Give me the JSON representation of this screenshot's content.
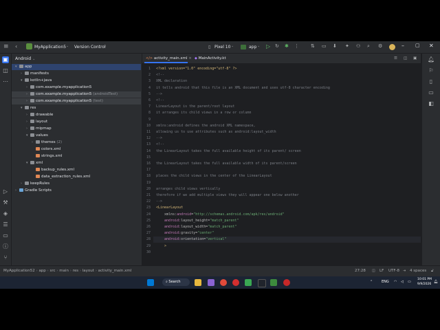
{
  "titlebar": {
    "project": "MyApplication5",
    "vcs": "Version Control",
    "device": "Pixel 10",
    "run_config": "app"
  },
  "project_panel": {
    "view": "Android",
    "tree": [
      {
        "label": "app",
        "indent": 0,
        "arrow": "▾",
        "kind": "folder",
        "selected": true
      },
      {
        "label": "manifests",
        "indent": 1,
        "arrow": "›",
        "kind": "folder"
      },
      {
        "label": "kotlin+java",
        "indent": 1,
        "arrow": "▾",
        "kind": "folder"
      },
      {
        "label": "com.example.myapplication5",
        "indent": 2,
        "arrow": "›",
        "kind": "pkg"
      },
      {
        "label": "com.example.myapplication5",
        "suffix": "(androidTest)",
        "indent": 2,
        "arrow": "›",
        "kind": "pkg",
        "highlight": true
      },
      {
        "label": "com.example.myapplication5",
        "suffix": "(test)",
        "indent": 2,
        "arrow": "›",
        "kind": "pkg",
        "highlight": true
      },
      {
        "label": "res",
        "indent": 1,
        "arrow": "▾",
        "kind": "folder"
      },
      {
        "label": "drawable",
        "indent": 2,
        "arrow": "›",
        "kind": "folder"
      },
      {
        "label": "layout",
        "indent": 2,
        "arrow": "›",
        "kind": "folder"
      },
      {
        "label": "mipmap",
        "indent": 2,
        "arrow": "›",
        "kind": "folder"
      },
      {
        "label": "values",
        "indent": 2,
        "arrow": "▾",
        "kind": "folder"
      },
      {
        "label": "themes",
        "suffix": "(2)",
        "indent": 3,
        "arrow": "›",
        "kind": "folder"
      },
      {
        "label": "colors.xml",
        "indent": 3,
        "arrow": "",
        "kind": "xml"
      },
      {
        "label": "strings.xml",
        "indent": 3,
        "arrow": "",
        "kind": "xml"
      },
      {
        "label": "xml",
        "indent": 2,
        "arrow": "▾",
        "kind": "folder"
      },
      {
        "label": "backup_rules.xml",
        "indent": 3,
        "arrow": "",
        "kind": "xml"
      },
      {
        "label": "data_extraction_rules.xml",
        "indent": 3,
        "arrow": "",
        "kind": "xml"
      },
      {
        "label": "keepRules",
        "indent": 1,
        "arrow": "›",
        "kind": "folder"
      },
      {
        "label": "Gradle Scripts",
        "indent": 0,
        "arrow": "›",
        "kind": "gradle"
      }
    ]
  },
  "editor": {
    "tabs": [
      "activity_main.xml",
      "MainActivity.kt"
    ],
    "lines": [
      [
        {
          "t": "<?xml version=\"1.0\" encoding=\"utf-8\" ?>",
          "c": "tag"
        }
      ],
      [
        {
          "t": "<!--",
          "c": "cmt"
        }
      ],
      [
        {
          "t": "XML declaration",
          "c": "cmt"
        }
      ],
      [
        {
          "t": "it tells android that this file is an XML document and uses utf-8 character encoding",
          "c": "cmt"
        }
      ],
      [
        {
          "t": "-->",
          "c": "cmt"
        }
      ],
      [
        {
          "t": "<!--",
          "c": "cmt"
        }
      ],
      [
        {
          "t": "LinearLayout is the parent/root layout",
          "c": "cmt"
        }
      ],
      [
        {
          "t": "it arranges its child views in a row or column",
          "c": "cmt"
        }
      ],
      [
        {
          "t": "",
          "c": "cmt"
        }
      ],
      [
        {
          "t": "xmlns:android defines the android XML namespace,",
          "c": "cmt"
        }
      ],
      [
        {
          "t": "allowing us to use attributes such as android:layout_width",
          "c": "cmt"
        }
      ],
      [
        {
          "t": "-->",
          "c": "cmt"
        }
      ],
      [
        {
          "t": "<!--",
          "c": "cmt"
        }
      ],
      [
        {
          "t": "the LinearLayout takes the full available height of its parent/ screen",
          "c": "cmt"
        }
      ],
      [
        {
          "t": "",
          "c": "cmt"
        }
      ],
      [
        {
          "t": "the LinearLayout takes the full available width of its parent/screen",
          "c": "cmt"
        }
      ],
      [
        {
          "t": "",
          "c": "cmt"
        }
      ],
      [
        {
          "t": "places the child views in the center of the LinearLayout",
          "c": "cmt"
        }
      ],
      [
        {
          "t": "",
          "c": "cmt"
        }
      ],
      [
        {
          "t": "arranges child views vertically",
          "c": "cmt"
        }
      ],
      [
        {
          "t": "therefore if we add multiple views they will appear one below another",
          "c": "cmt"
        }
      ],
      [
        {
          "t": "-->",
          "c": "cmt"
        }
      ],
      [
        {
          "t": "<LinearLayout",
          "c": "tag"
        }
      ],
      [
        {
          "t": "    xmlns:",
          "c": "attr"
        },
        {
          "t": "android",
          "c": "ns"
        },
        {
          "t": "=",
          "c": "attr"
        },
        {
          "t": "\"http://schemas.android.com/apk/res/android\"",
          "c": "val"
        }
      ],
      [
        {
          "t": "    android:",
          "c": "ns"
        },
        {
          "t": "layout_height",
          "c": "attr"
        },
        {
          "t": "=",
          "c": "attr"
        },
        {
          "t": "\"match_parent\"",
          "c": "val"
        }
      ],
      [
        {
          "t": "    android:",
          "c": "ns"
        },
        {
          "t": "layout_width",
          "c": "attr"
        },
        {
          "t": "=",
          "c": "attr"
        },
        {
          "t": "\"match_parent\"",
          "c": "val"
        }
      ],
      [
        {
          "t": "    android:",
          "c": "ns"
        },
        {
          "t": "gravity",
          "c": "attr"
        },
        {
          "t": "=",
          "c": "attr"
        },
        {
          "t": "\"center\"",
          "c": "val"
        }
      ],
      [
        {
          "t": "    android:",
          "c": "ns"
        },
        {
          "t": "orientation",
          "c": "attr"
        },
        {
          "t": "=",
          "c": "attr"
        },
        {
          "t": "\"vertical\"",
          "c": "val"
        }
      ],
      [
        {
          "t": "    >",
          "c": "tag"
        }
      ],
      [
        {
          "t": "",
          "c": "cmt"
        }
      ]
    ],
    "current_line": 28
  },
  "statusbar": {
    "breadcrumb": [
      "MyApplication52",
      "app",
      "src",
      "main",
      "res",
      "layout",
      "activity_main.xml"
    ],
    "position": "27:28",
    "line_sep": "LF",
    "encoding": "UTF-8",
    "indent": "4 spaces"
  },
  "taskbar": {
    "search": "Search",
    "lang": "ENG",
    "time": "10:01 PM",
    "date": "9/9/2026"
  },
  "colors": {
    "accent": "#3574f0",
    "selection": "#2e436e",
    "ide_bg": "#1e1f22",
    "panel_bg": "#2b2d30"
  }
}
